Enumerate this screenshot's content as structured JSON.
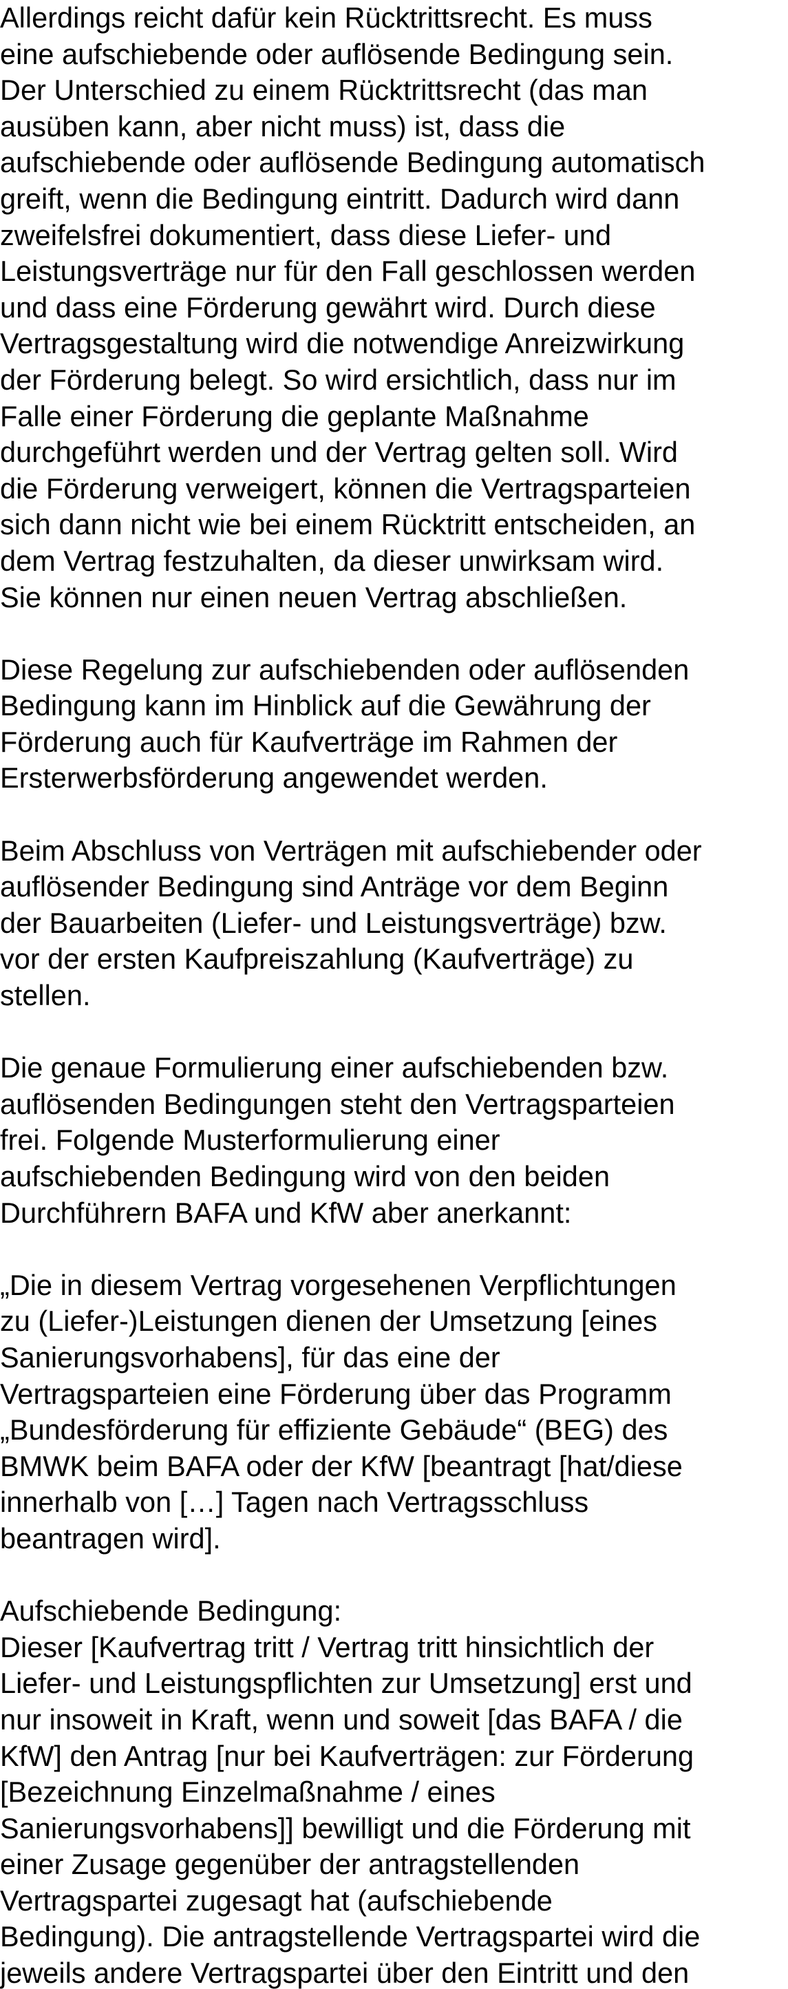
{
  "document": {
    "paragraphs": [
      {
        "lines": [
          "Allerdings reicht dafür kein Rücktrittsrecht. Es muss",
          "eine aufschiebende oder auflösende Bedingung sein.",
          "Der Unterschied zu einem Rücktrittsrecht (das man",
          "ausüben kann, aber nicht muss) ist, dass die",
          "aufschiebende oder auflösende Bedingung automatisch",
          "greift, wenn die Bedingung eintritt. Dadurch wird dann",
          "zweifelsfrei dokumentiert, dass diese Liefer- und",
          "Leistungsverträge nur für den Fall geschlossen werden",
          "und dass eine Förderung gewährt wird. Durch diese",
          "Vertragsgestaltung wird die notwendige Anreizwirkung",
          "der Förderung belegt. So wird ersichtlich, dass nur im",
          "Falle einer Förderung die geplante Maßnahme",
          "durchgeführt werden und der Vertrag gelten soll. Wird",
          "die Förderung verweigert, können die Vertragsparteien",
          "sich dann nicht wie bei einem Rücktritt entscheiden, an",
          "dem Vertrag festzuhalten, da dieser unwirksam wird.",
          "Sie können nur einen neuen Vertrag abschließen."
        ]
      },
      {
        "lines": [
          "Diese Regelung zur aufschiebenden oder auflösenden",
          "Bedingung kann im Hinblick auf die Gewährung der",
          "Förderung auch für Kaufverträge im Rahmen der",
          "Ersterwerbsförderung angewendet werden."
        ]
      },
      {
        "lines": [
          "Beim Abschluss von Verträgen mit aufschiebender oder",
          "auflösender Bedingung sind Anträge vor dem Beginn",
          "der Bauarbeiten (Liefer- und Leistungsverträge) bzw.",
          "vor der ersten Kaufpreiszahlung (Kaufverträge) zu",
          "stellen."
        ]
      },
      {
        "lines": [
          "Die genaue Formulierung einer aufschiebenden bzw.",
          "auflösenden Bedingungen steht den Vertragsparteien",
          "frei. Folgende Musterformulierung einer",
          "aufschiebenden Bedingung wird von den beiden",
          "Durchführern BAFA und KfW aber anerkannt:"
        ]
      },
      {
        "lines": [
          "„Die in diesem Vertrag vorgesehenen Verpflichtungen",
          "zu (Liefer-)Leistungen dienen der Umsetzung [eines",
          "Sanierungsvorhabens], für das eine der",
          "Vertragsparteien eine Förderung über das Programm",
          "„Bundesförderung für effiziente Gebäude“ (BEG) des",
          "BMWK beim BAFA oder der KfW [beantragt [hat/diese",
          "innerhalb von […] Tagen nach Vertragsschluss",
          "beantragen wird]."
        ]
      },
      {
        "lines": [
          "Aufschiebende Bedingung:",
          "Dieser [Kaufvertrag tritt / Vertrag tritt hinsichtlich der",
          "Liefer- und Leistungspflichten zur Umsetzung] erst und",
          "nur insoweit in Kraft, wenn und soweit [das BAFA / die",
          "KfW] den Antrag [nur bei Kaufverträgen: zur Förderung",
          "[Bezeichnung Einzelmaßnahme / eines",
          "Sanierungsvorhabens]] bewilligt und die Förderung mit",
          "einer Zusage gegenüber der antragstellenden",
          "Vertragspartei zugesagt hat (aufschiebende",
          "Bedingung). Die antragstellende Vertragspartei wird die",
          "jeweils andere Vertragspartei über den Eintritt und den"
        ]
      }
    ]
  }
}
